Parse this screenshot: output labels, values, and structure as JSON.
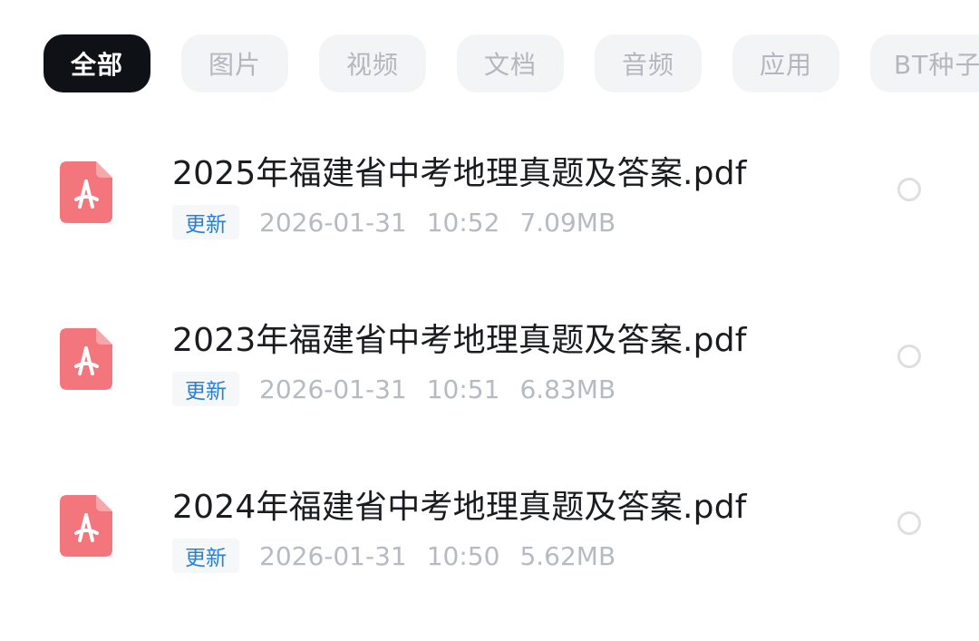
{
  "filters": [
    {
      "label": "全部",
      "active": true
    },
    {
      "label": "图片",
      "active": false
    },
    {
      "label": "视频",
      "active": false
    },
    {
      "label": "文档",
      "active": false
    },
    {
      "label": "音频",
      "active": false
    },
    {
      "label": "应用",
      "active": false
    },
    {
      "label": "BT种子",
      "active": false
    }
  ],
  "files": [
    {
      "name": "2025年福建省中考地理真题及答案.pdf",
      "badge": "更新",
      "date": "2026-01-31",
      "time": "10:52",
      "size": "7.09MB",
      "icon": "pdf-file-icon"
    },
    {
      "name": "2023年福建省中考地理真题及答案.pdf",
      "badge": "更新",
      "date": "2026-01-31",
      "time": "10:51",
      "size": "6.83MB",
      "icon": "pdf-file-icon"
    },
    {
      "name": "2024年福建省中考地理真题及答案.pdf",
      "badge": "更新",
      "date": "2026-01-31",
      "time": "10:50",
      "size": "5.62MB",
      "icon": "pdf-file-icon"
    }
  ],
  "colors": {
    "active_chip_bg": "#0e1217",
    "chip_bg": "#f3f4f6",
    "pdf_icon": "#f2767c",
    "badge_text": "#2a7fd0"
  }
}
